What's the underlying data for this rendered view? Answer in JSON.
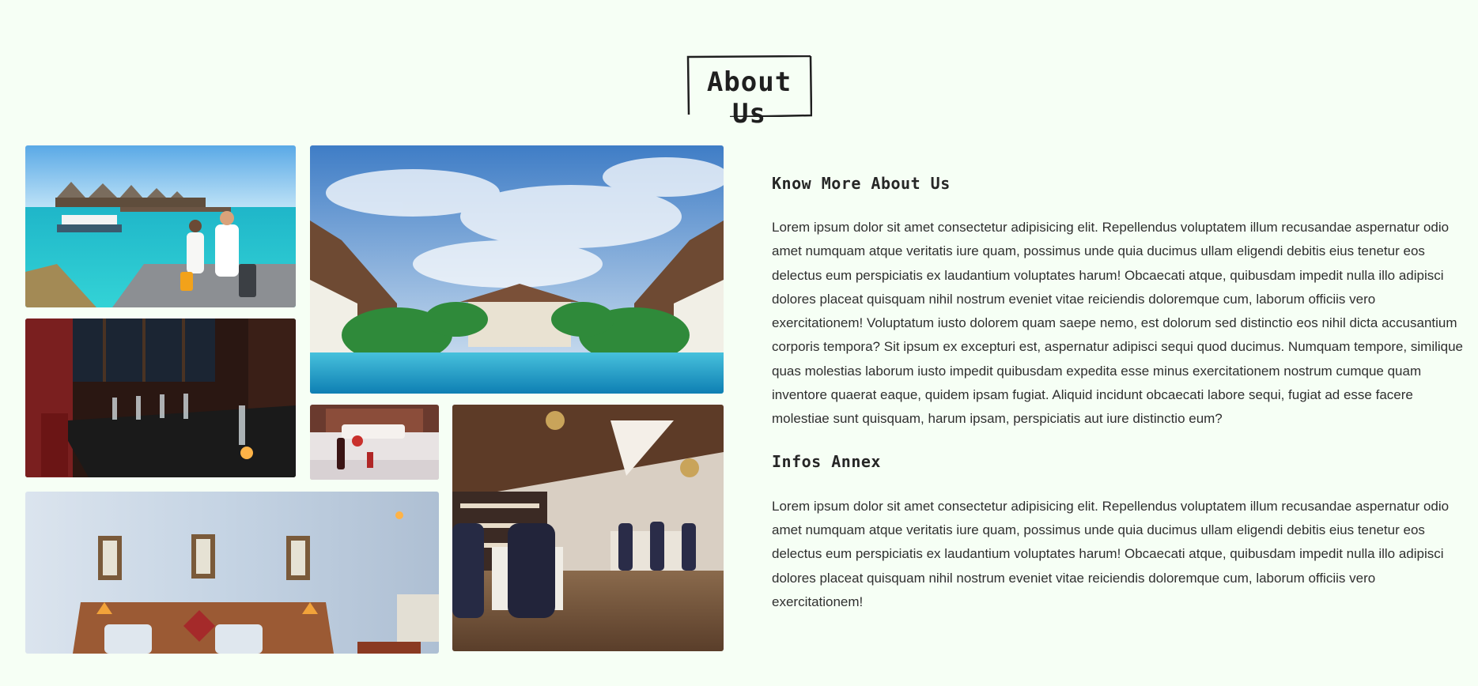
{
  "section": {
    "title": "About Us"
  },
  "gallery": {
    "images": [
      {
        "name": "maldives-couple-pier",
        "description_icon": "photo-icon"
      },
      {
        "name": "resort-pool-courtyard",
        "description_icon": "photo-icon"
      },
      {
        "name": "restaurant-wine-table",
        "description_icon": "photo-icon"
      },
      {
        "name": "hotel-bed-wine",
        "description_icon": "photo-icon"
      },
      {
        "name": "dining-hall",
        "description_icon": "photo-icon"
      },
      {
        "name": "hotel-bedroom",
        "description_icon": "photo-icon"
      }
    ]
  },
  "about": {
    "heading1": "Know More About Us",
    "paragraph1": "Lorem ipsum dolor sit amet consectetur adipisicing elit. Repellendus voluptatem illum recusandae aspernatur odio amet numquam atque veritatis iure quam, possimus unde quia ducimus ullam eligendi debitis eius tenetur eos delectus eum perspiciatis ex laudantium voluptates harum! Obcaecati atque, quibusdam impedit nulla illo adipisci dolores placeat quisquam nihil nostrum eveniet vitae reiciendis doloremque cum, laborum officiis vero exercitationem! Voluptatum iusto dolorem quam saepe nemo, est dolorum sed distinctio eos nihil dicta accusantium corporis tempora? Sit ipsum ex excepturi est, aspernatur adipisci sequi quod ducimus. Numquam tempore, similique quas molestias laborum iusto impedit quibusdam expedita esse minus exercitationem nostrum cumque quam inventore quaerat eaque, quidem ipsam fugiat. Aliquid incidunt obcaecati labore sequi, fugiat ad esse facere molestiae sunt quisquam, harum ipsam, perspiciatis aut iure distinctio eum?",
    "heading2": "Infos Annex",
    "paragraph2": "Lorem ipsum dolor sit amet consectetur adipisicing elit. Repellendus voluptatem illum recusandae aspernatur odio amet numquam atque veritatis iure quam, possimus unde quia ducimus ullam eligendi debitis eius tenetur eos delectus eum perspiciatis ex laudantium voluptates harum! Obcaecati atque, quibusdam impedit nulla illo adipisci dolores placeat quisquam nihil nostrum eveniet vitae reiciendis doloremque cum, laborum officiis vero exercitationem!"
  },
  "colors": {
    "background": "#f6fff5",
    "text": "#2f2f2f",
    "heading": "#262626"
  }
}
